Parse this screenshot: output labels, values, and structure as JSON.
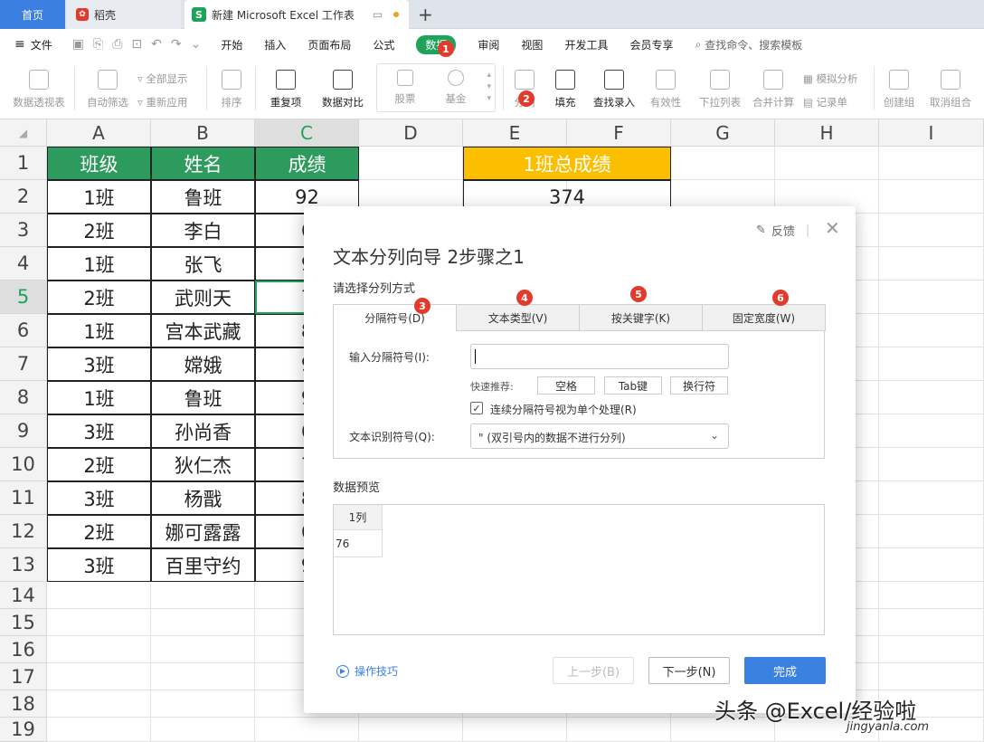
{
  "tabs": {
    "home": "首页",
    "docer": "稻壳",
    "excel": "新建 Microsoft Excel 工作表",
    "plus": "+"
  },
  "menu": {
    "file": "文件",
    "items": [
      "开始",
      "插入",
      "页面布局",
      "公式",
      "数据",
      "审阅",
      "视图",
      "开发工具",
      "会员专享"
    ],
    "search": "查找命令、搜索模板"
  },
  "ribbon": {
    "pivot": "数据透视表",
    "autofilter": "自动筛选",
    "show_all": "全部显示",
    "reapply": "重新应用",
    "sort": "排序",
    "duplicate": "重复项",
    "compare": "数据对比",
    "stock": "股票",
    "fund": "基金",
    "split": "分列",
    "fill": "填充",
    "lookup": "查找录入",
    "validity": "有效性",
    "dropdown": "下拉列表",
    "consolidate": "合并计算",
    "simulate": "模拟分析",
    "record": "记录单",
    "group": "创建组",
    "ungroup": "取消组合"
  },
  "badges": [
    "1",
    "2",
    "3",
    "4",
    "5",
    "6"
  ],
  "sheet": {
    "columns": [
      "A",
      "B",
      "C",
      "D",
      "E",
      "F",
      "G",
      "H",
      "I"
    ],
    "rows": [
      "1",
      "2",
      "3",
      "4",
      "5",
      "6",
      "7",
      "8",
      "9",
      "10",
      "11",
      "12",
      "13",
      "14",
      "15",
      "16",
      "17",
      "18",
      "19"
    ],
    "headers": [
      "班级",
      "姓名",
      "成绩"
    ],
    "data": [
      [
        "1班",
        "鲁班",
        "92"
      ],
      [
        "2班",
        "李白",
        "6"
      ],
      [
        "1班",
        "张飞",
        "9"
      ],
      [
        "2班",
        "武则天",
        "7"
      ],
      [
        "1班",
        "宫本武藏",
        "8"
      ],
      [
        "3班",
        "嫦娥",
        "9"
      ],
      [
        "1班",
        "鲁班",
        "9"
      ],
      [
        "3班",
        "孙尚香",
        "6"
      ],
      [
        "2班",
        "狄仁杰",
        "7"
      ],
      [
        "3班",
        "杨戬",
        "8"
      ],
      [
        "2班",
        "娜可露露",
        "6"
      ],
      [
        "3班",
        "百里守约",
        "9"
      ]
    ],
    "total_label": "1班总成绩",
    "total_value": "374"
  },
  "dialog": {
    "title": "文本分列向导 2步骤之1",
    "feedback": "反馈",
    "subtitle": "请选择分列方式",
    "tabs": [
      "分隔符号(D)",
      "文本类型(V)",
      "按关键字(K)",
      "固定宽度(W)"
    ],
    "sep_label": "输入分隔符号(I):",
    "sep_value": "",
    "quick_label": "快速推荐:",
    "quick": [
      "空格",
      "Tab键",
      "换行符"
    ],
    "consecutive": "连续分隔符号视为单个处理(R)",
    "qualifier_label": "文本识别符号(Q):",
    "qualifier_value": "\"  (双引号内的数据不进行分列)",
    "preview_label": "数据预览",
    "preview_col": "1列",
    "preview_val": "76",
    "tips": "操作技巧",
    "prev": "上一步(B)",
    "next": "下一步(N)",
    "finish": "完成"
  },
  "watermark": {
    "main": "头条 @Excel/经验啦",
    "sub": "jingyanla.com"
  }
}
